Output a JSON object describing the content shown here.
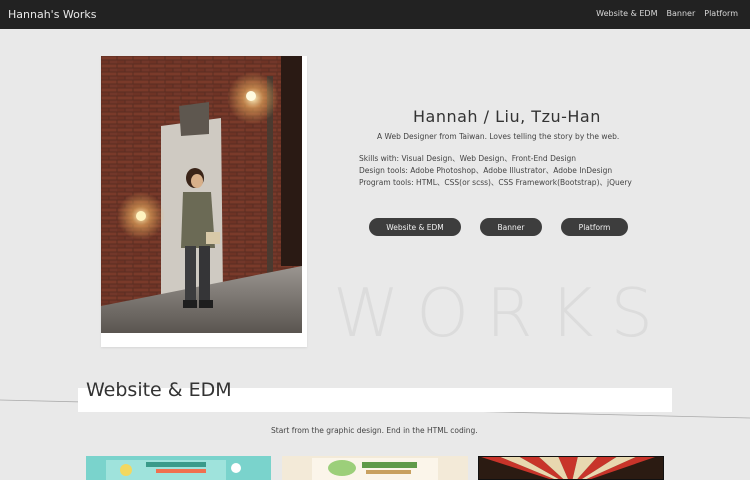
{
  "brand": "Hannah's Works",
  "nav": [
    "Website & EDM",
    "Banner",
    "Platform"
  ],
  "profile": {
    "name": "Hannah / Liu, Tzu-Han",
    "tagline": "A Web Designer from Taiwan. Loves telling the story by the web.",
    "skills": [
      "Skills with: Visual Design、Web Design、Front-End Design",
      "Design tools: Adobe Photoshop、Adobe Illustrator、Adobe InDesign",
      "Program tools: HTML、CSS(or scss)、CSS Framework(Bootstrap)、jQuery"
    ]
  },
  "buttons": [
    "Website & EDM",
    "Banner",
    "Platform"
  ],
  "works_bg": "WORKS",
  "section": {
    "title": "Website & EDM",
    "subtitle": "Start from the graphic design. End in the HTML coding."
  },
  "colors": {
    "topbar": "#222222",
    "page": "#e9e9e9",
    "button": "#3d3d3d"
  }
}
